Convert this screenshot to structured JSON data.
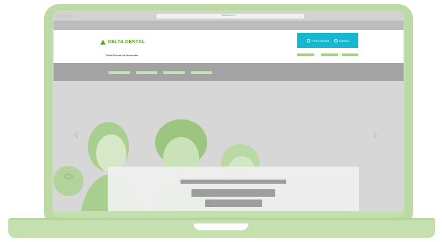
{
  "browser": {
    "window_controls": "• • •  ‹  ›",
    "url": "deltadental.org",
    "tab_close": "×"
  },
  "site": {
    "logo_text": "DELTA DENTAL",
    "logo_sub": "Delta Dental of Nebraska",
    "cta_find": "Find A Dentist",
    "cta_contact": "Contact",
    "search_icon": "⌕"
  },
  "hero": {
    "prev_arrow": "‹",
    "next_arrow": "›"
  },
  "colors": {
    "brand_green": "#5aa032",
    "cta_teal": "#17b8cf",
    "laptop_green": "#c4e0af"
  }
}
